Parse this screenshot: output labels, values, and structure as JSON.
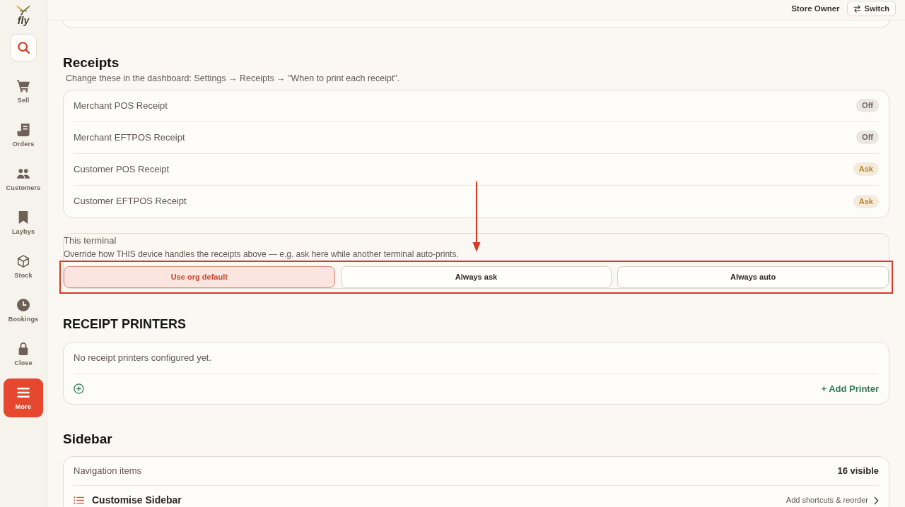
{
  "sidebar": {
    "logo": "fly",
    "items": [
      {
        "label": "Sell",
        "selected": false
      },
      {
        "label": "Orders",
        "selected": false
      },
      {
        "label": "Customers",
        "selected": false
      },
      {
        "label": "Laybys",
        "selected": false
      },
      {
        "label": "Stock",
        "selected": false
      },
      {
        "label": "Bookings",
        "selected": false
      },
      {
        "label": "Close",
        "selected": false
      },
      {
        "label": "More",
        "selected": true
      }
    ]
  },
  "header": {
    "user": "Store Owner",
    "switch_button": "Switch"
  },
  "receipts": {
    "title": "Receipts",
    "hint": "Change these in the dashboard: Settings → Receipts → \"When to print each receipt\".",
    "rows": [
      {
        "label": "Merchant POS Receipt",
        "value": "Off",
        "color": "#6f665d"
      },
      {
        "label": "Merchant EFTPOS Receipt",
        "value": "Off",
        "color": "#6f665d"
      },
      {
        "label": "Customer POS Receipt",
        "value": "Ask",
        "color": "#b7852f"
      },
      {
        "label": "Customer EFTPOS Receipt",
        "value": "Ask",
        "color": "#b7852f"
      }
    ]
  },
  "terminal": {
    "title": "This terminal",
    "description": "Override how THIS device handles the receipts above — e.g. ask here while another terminal auto-prints.",
    "options": [
      {
        "label": "Use org default",
        "selected": true
      },
      {
        "label": "Always ask",
        "selected": false
      },
      {
        "label": "Always auto",
        "selected": false
      }
    ]
  },
  "printers": {
    "title": "RECEIPT PRINTERS",
    "empty_text": "No receipt printers configured yet.",
    "add_button": "+ Add Printer"
  },
  "sidebar_settings": {
    "title": "Sidebar",
    "navigation_label": "Navigation items",
    "navigation_count": "16 visible",
    "customise": {
      "label": "Customise Sidebar",
      "hint": "Add shortcuts & reorder"
    }
  }
}
